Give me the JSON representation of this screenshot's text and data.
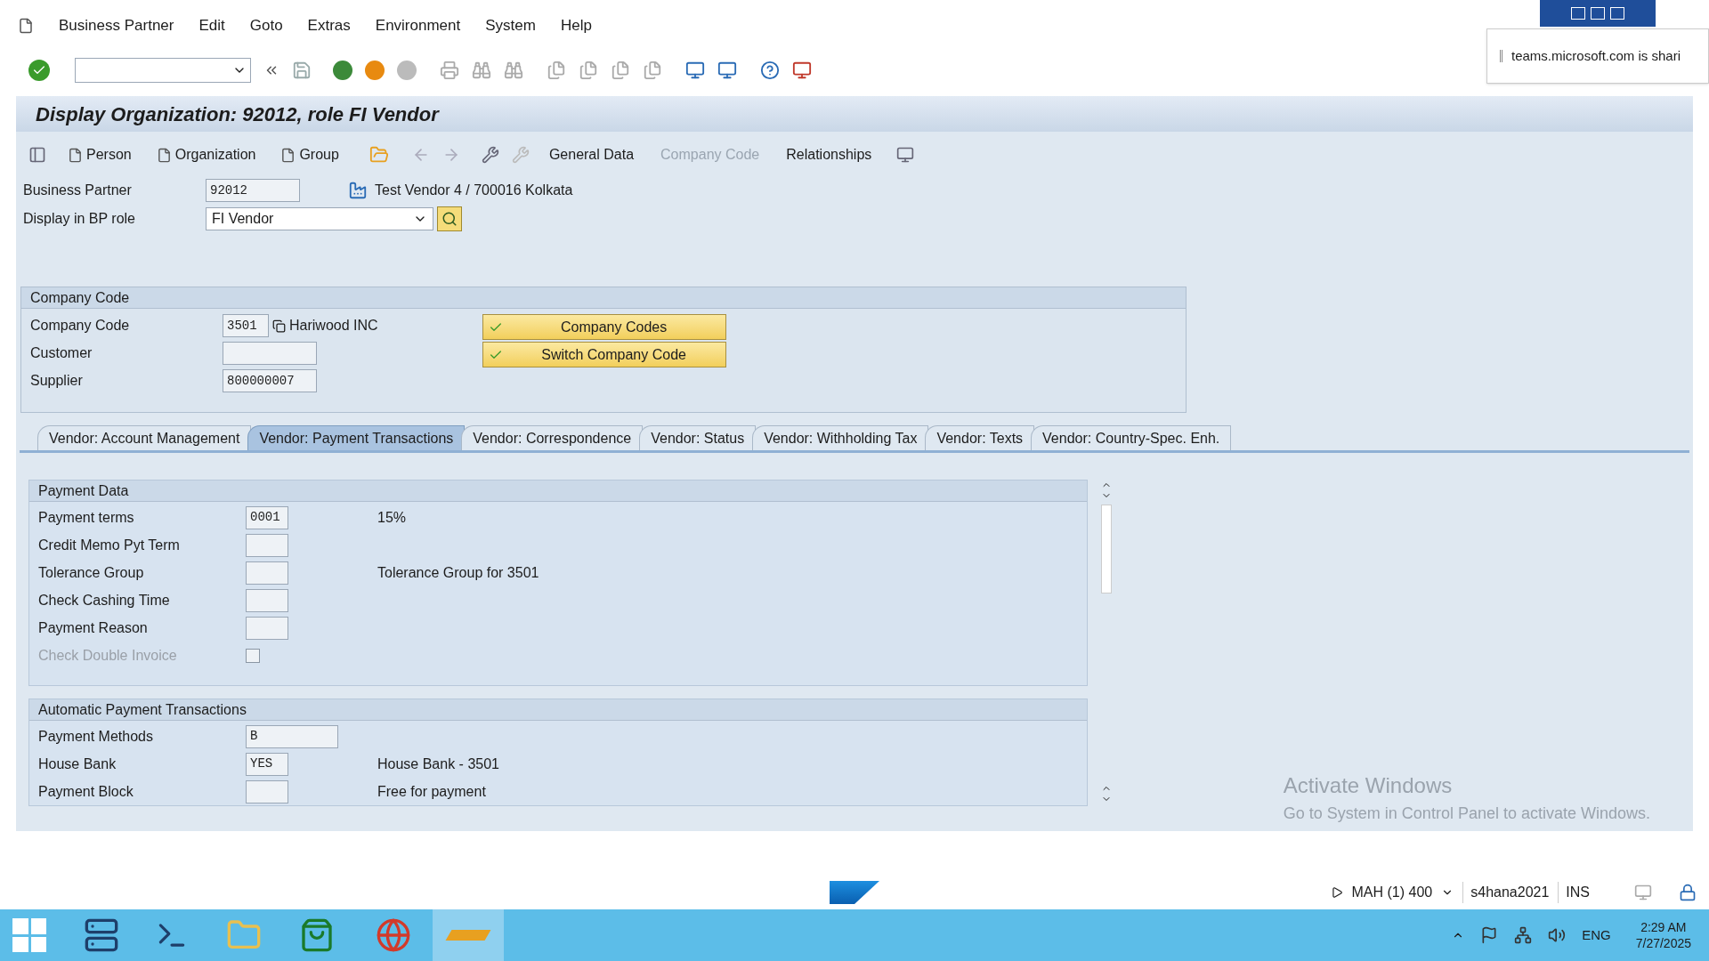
{
  "menu": [
    "Business Partner",
    "Edit",
    "Goto",
    "Extras",
    "Environment",
    "System",
    "Help"
  ],
  "notification": "teams.microsoft.com is shari",
  "title": "Display Organization: 92012, role FI Vendor",
  "create_buttons": [
    "Person",
    "Organization",
    "Group"
  ],
  "view_buttons": [
    {
      "label": "General Data",
      "disabled": false
    },
    {
      "label": "Company Code",
      "disabled": true
    },
    {
      "label": "Relationships",
      "disabled": false
    }
  ],
  "header": {
    "business_partner": {
      "label": "Business Partner",
      "value": "92012",
      "description": "Test Vendor 4 / 700016 Kolkata"
    },
    "bp_role": {
      "label": "Display in BP role",
      "value": "FI Vendor"
    }
  },
  "company_code_panel": {
    "title": "Company Code",
    "fields": [
      {
        "label": "Company Code",
        "value": "3501",
        "description": "Hariwood INC"
      },
      {
        "label": "Customer"
      },
      {
        "label": "Supplier",
        "value": "800000007"
      }
    ],
    "buttons": [
      "Company Codes",
      "Switch Company Code"
    ]
  },
  "tabs": [
    {
      "label": "Vendor: Account Management",
      "selected": false
    },
    {
      "label": "Vendor: Payment Transactions",
      "selected": true
    },
    {
      "label": "Vendor: Correspondence",
      "selected": false
    },
    {
      "label": "Vendor: Status",
      "selected": false
    },
    {
      "label": "Vendor: Withholding Tax",
      "selected": false
    },
    {
      "label": "Vendor: Texts",
      "selected": false
    },
    {
      "label": "Vendor: Country-Spec. Enh.",
      "selected": false
    }
  ],
  "sections": [
    {
      "title": "Payment Data",
      "rows": [
        {
          "kind": "field",
          "label": "Payment terms",
          "value": "0001",
          "description": "15%",
          "disabled": false
        },
        {
          "kind": "field",
          "label": "Credit Memo Pyt Term",
          "disabled": false
        },
        {
          "kind": "field",
          "label": "Tolerance Group",
          "description": "Tolerance Group for 3501",
          "disabled": false
        },
        {
          "kind": "field",
          "label": "Check Cashing Time",
          "disabled": false
        },
        {
          "kind": "field",
          "label": "Payment Reason",
          "disabled": false
        },
        {
          "kind": "checkbox",
          "label": "Check Double Invoice",
          "checked": false,
          "disabled": true
        }
      ]
    },
    {
      "title": "Automatic Payment Transactions",
      "rows": [
        {
          "kind": "field",
          "label": "Payment Methods",
          "value": "B",
          "disabled": false
        },
        {
          "kind": "field",
          "label": "House Bank",
          "value": "YES",
          "description": "House Bank - 3501",
          "disabled": false
        },
        {
          "kind": "field",
          "label": "Payment Block",
          "description": "Free for payment",
          "disabled": false
        }
      ]
    }
  ],
  "activation": {
    "title": "Activate Windows",
    "text": "Go to System in Control Panel to activate Windows."
  },
  "status": {
    "session": "MAH (1) 400",
    "server": "s4hana2021",
    "mode": "INS"
  },
  "taskbar": {
    "language": "ENG",
    "time": "2:29 AM",
    "date": "7/27/2025"
  }
}
